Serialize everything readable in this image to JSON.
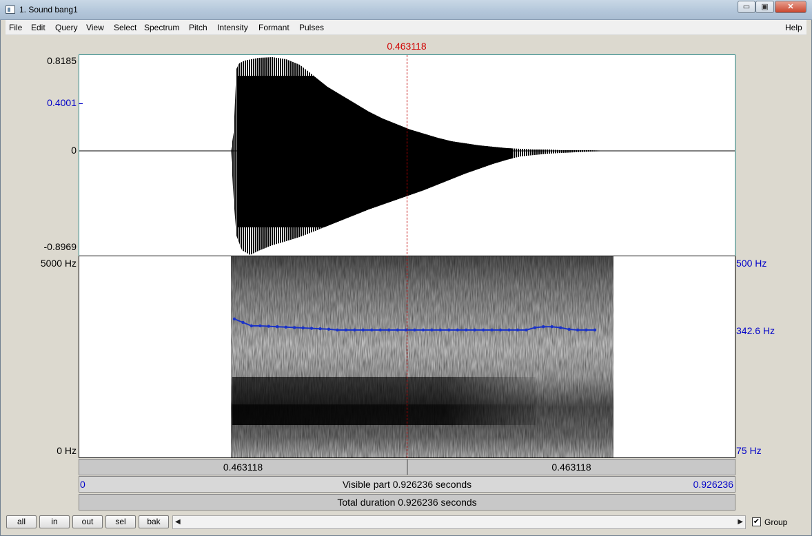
{
  "window": {
    "title": "1. Sound bang1",
    "controls": {
      "minimize": "▭",
      "maximize": "▣",
      "close": "✕"
    }
  },
  "menu": {
    "items": [
      "File",
      "Edit",
      "Query",
      "View",
      "Select",
      "Spectrum",
      "Pitch",
      "Intensity",
      "Formant",
      "Pulses"
    ],
    "help": "Help"
  },
  "cursor_time": "0.463118",
  "waveform": {
    "y_max": "0.8185",
    "y_mid": "0.4001",
    "y_zero": "0",
    "y_min": "-0.8969",
    "colors": {
      "axis_mid": "#0000c8",
      "signal": "#000000"
    }
  },
  "spectrogram": {
    "freq_top": "5000 Hz",
    "freq_bottom": "0 Hz",
    "pitch_top": "500 Hz",
    "pitch_value": "342.6 Hz",
    "pitch_bottom": "75 Hz",
    "colors": {
      "pitch_line": "#1a32c8"
    }
  },
  "selection": {
    "left_label": "0.463118",
    "right_label": "0.463118"
  },
  "visible": {
    "label": "Visible part 0.926236 seconds",
    "start": "0",
    "end": "0.926236"
  },
  "total": {
    "label": "Total duration 0.926236 seconds"
  },
  "buttons": {
    "all": "all",
    "in": "in",
    "out": "out",
    "sel": "sel",
    "bak": "bak"
  },
  "group": {
    "label": "Group",
    "checked": true,
    "check_mark": "✔"
  },
  "scroll": {
    "left_arrow": "◀",
    "right_arrow": "▶"
  }
}
